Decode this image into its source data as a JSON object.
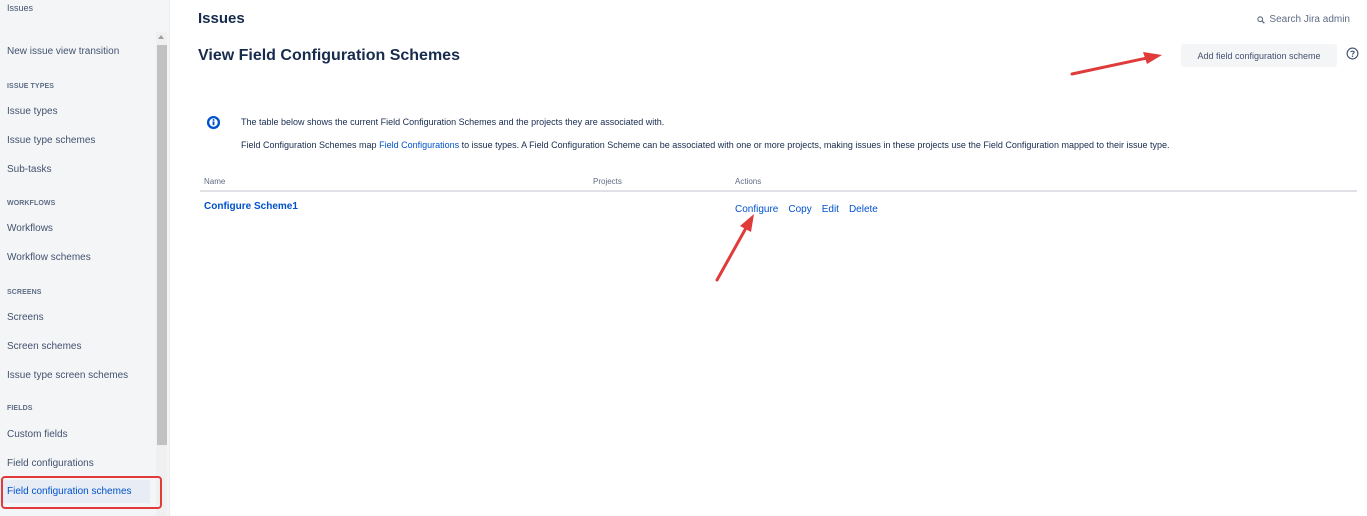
{
  "sidebar": {
    "top_label": "Issues",
    "items": [
      {
        "label": "New issue view transition"
      },
      {
        "heading": "ISSUE TYPES"
      },
      {
        "label": "Issue types"
      },
      {
        "label": "Issue type schemes"
      },
      {
        "label": "Sub-tasks"
      },
      {
        "heading": "WORKFLOWS"
      },
      {
        "label": "Workflows"
      },
      {
        "label": "Workflow schemes"
      },
      {
        "heading": "SCREENS"
      },
      {
        "label": "Screens"
      },
      {
        "label": "Screen schemes"
      },
      {
        "label": "Issue type screen schemes"
      },
      {
        "heading": "FIELDS"
      },
      {
        "label": "Custom fields"
      },
      {
        "label": "Field configurations"
      },
      {
        "label": "Field configuration schemes",
        "active": true
      }
    ]
  },
  "header": {
    "section_title": "Issues",
    "search_label": "Search Jira admin",
    "page_title": "View Field Configuration Schemes",
    "add_button_label": "Add field configuration scheme"
  },
  "info": {
    "line1": "The table below shows the current Field Configuration Schemes and the projects they are associated with.",
    "line2_prefix": "Field Configuration Schemes map ",
    "line2_link": "Field Configurations",
    "line2_suffix": " to issue types. A Field Configuration Scheme can be associated with one or more projects, making issues in these projects use the Field Configuration mapped to their issue type."
  },
  "table": {
    "columns": [
      "Name",
      "Projects",
      "Actions"
    ],
    "rows": [
      {
        "name": "Configure Scheme1",
        "projects": "",
        "actions": [
          "Configure",
          "Copy",
          "Edit",
          "Delete"
        ]
      }
    ]
  },
  "colors": {
    "link": "#0052cc",
    "annotation": "#e03b3b",
    "sidebar_bg": "#f4f5f7"
  }
}
